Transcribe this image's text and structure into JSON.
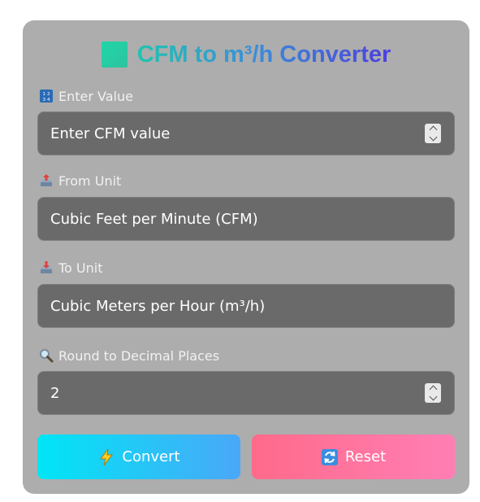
{
  "title": {
    "text": "CFM to m³/h Converter",
    "icon": "green-square-icon"
  },
  "form": {
    "value_label": "Enter Value",
    "value_label_icon": "input-numbers-icon",
    "value_placeholder": "Enter CFM value",
    "from_label": "From Unit",
    "from_label_icon": "outbox-tray-icon",
    "from_value": "Cubic Feet per Minute (CFM)",
    "to_label": "To Unit",
    "to_label_icon": "inbox-tray-icon",
    "to_value": "Cubic Meters per Hour (m³/h)",
    "decimal_label": "Round to Decimal Places",
    "decimal_label_icon": "magnifying-glass-icon",
    "decimal_value": "2"
  },
  "buttons": {
    "convert_label": "Convert",
    "convert_icon": "lightning-icon",
    "reset_label": "Reset",
    "reset_icon": "refresh-icon"
  },
  "colors": {
    "card_bg": "#adadad",
    "field_bg": "#6a6a6a",
    "convert_gradient": [
      "#00e6f6",
      "#4aa7f8"
    ],
    "reset_gradient": [
      "#ff6a8a",
      "#ff7fb4"
    ],
    "title_gradient": [
      "#20c3b0",
      "#4d3fe0"
    ]
  }
}
